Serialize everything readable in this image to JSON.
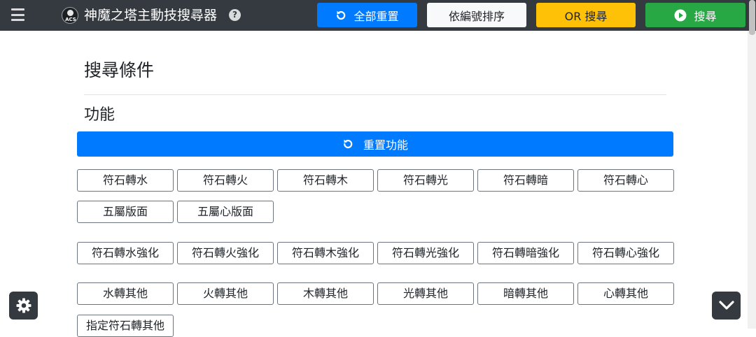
{
  "navbar": {
    "title": "神魔之塔主動技搜尋器",
    "logo_text": "ACS",
    "help_symbol": "?",
    "buttons": {
      "reset_all": "全部重置",
      "sort_by_id": "依編號排序",
      "or_search": "OR 搜尋",
      "search": "搜尋"
    },
    "colors": {
      "navbar_bg": "#343a40",
      "primary": "#007bff",
      "warning": "#ffc107",
      "success": "#28a745",
      "light": "#f8f9fa"
    }
  },
  "main": {
    "heading": "搜尋條件",
    "section_title": "功能",
    "reset_section_label": "重置功能",
    "options": {
      "row1": [
        "符石轉水",
        "符石轉火",
        "符石轉木",
        "符石轉光",
        "符石轉暗",
        "符石轉心"
      ],
      "row2": [
        "五屬版面",
        "五屬心版面"
      ],
      "row3": [
        "符石轉水強化",
        "符石轉火強化",
        "符石轉木強化",
        "符石轉光強化",
        "符石轉暗強化",
        "符石轉心強化"
      ],
      "row4": [
        "水轉其他",
        "火轉其他",
        "木轉其他",
        "光轉其他",
        "暗轉其他",
        "心轉其他"
      ],
      "row5": [
        "指定符石轉其他"
      ]
    }
  },
  "floating": {
    "settings_icon": "gear-icon",
    "scroll_down_icon": "chevron-down-icon"
  }
}
